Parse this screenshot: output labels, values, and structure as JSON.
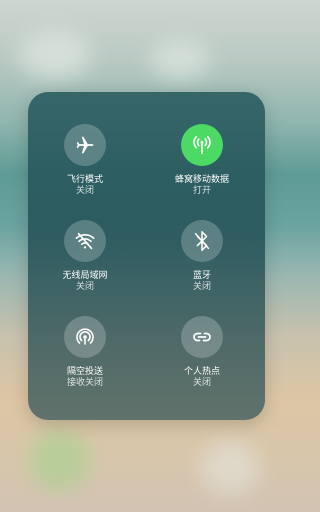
{
  "tiles": [
    {
      "label": "飞行模式",
      "status": "关闭",
      "icon": "airplane-icon",
      "active": false
    },
    {
      "label": "蜂窝移动数据",
      "status": "打开",
      "icon": "cellular-antenna-icon",
      "active": true
    },
    {
      "label": "无线局域网",
      "status": "关闭",
      "icon": "wifi-off-icon",
      "active": false
    },
    {
      "label": "蓝牙",
      "status": "关闭",
      "icon": "bluetooth-icon",
      "active": false
    },
    {
      "label": "隔空投送",
      "status": "接收关闭",
      "icon": "airdrop-icon",
      "active": false
    },
    {
      "label": "个人热点",
      "status": "关闭",
      "icon": "personal-hotspot-icon",
      "active": false
    }
  ],
  "colors": {
    "active": "#4cd964",
    "panel": "#285a5f"
  }
}
